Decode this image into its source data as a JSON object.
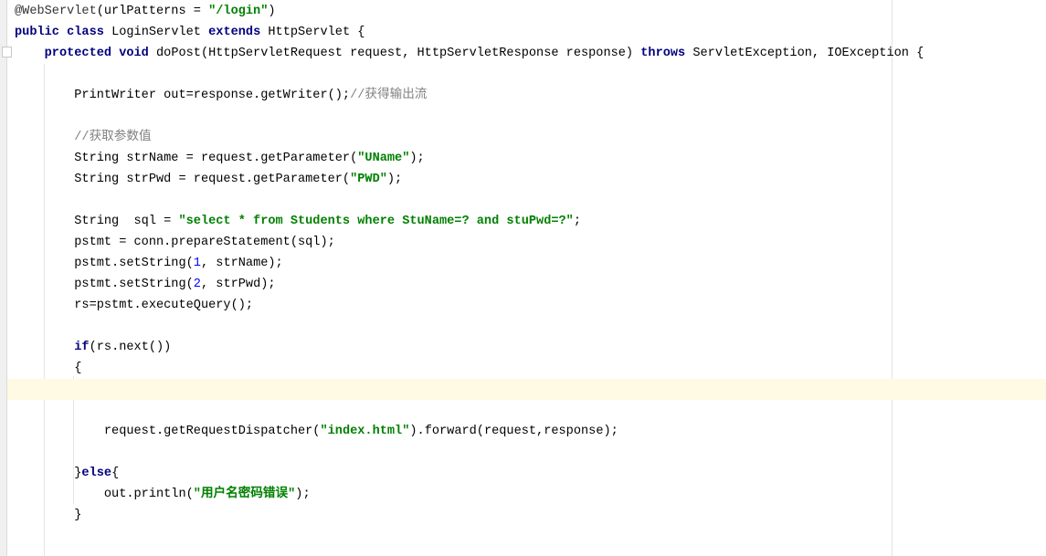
{
  "editor": {
    "current_line": 18,
    "lines": [
      [
        {
          "t": "@WebServlet",
          "c": "ann"
        },
        {
          "t": "(urlPatterns = ",
          "c": "plain"
        },
        {
          "t": "\"/login\"",
          "c": "str"
        },
        {
          "t": ")",
          "c": "plain"
        }
      ],
      [
        {
          "t": "public class ",
          "c": "kw"
        },
        {
          "t": "LoginServlet ",
          "c": "plain"
        },
        {
          "t": "extends ",
          "c": "kw"
        },
        {
          "t": "HttpServlet {",
          "c": "plain"
        }
      ],
      [
        {
          "t": "    protected void ",
          "c": "kw"
        },
        {
          "t": "doPost(HttpServletRequest request, HttpServletResponse response) ",
          "c": "plain"
        },
        {
          "t": "throws ",
          "c": "kw"
        },
        {
          "t": "ServletException, IOException {",
          "c": "plain"
        }
      ],
      [],
      [
        {
          "t": "        PrintWriter out=response.getWriter();",
          "c": "plain"
        },
        {
          "t": "//获得输出流",
          "c": "cmt"
        }
      ],
      [],
      [
        {
          "t": "        //获取参数值",
          "c": "cmt"
        }
      ],
      [
        {
          "t": "        String strName = request.getParameter(",
          "c": "plain"
        },
        {
          "t": "\"UName\"",
          "c": "str"
        },
        {
          "t": ");",
          "c": "plain"
        }
      ],
      [
        {
          "t": "        String strPwd = request.getParameter(",
          "c": "plain"
        },
        {
          "t": "\"PWD\"",
          "c": "str"
        },
        {
          "t": ");",
          "c": "plain"
        }
      ],
      [],
      [
        {
          "t": "        String  sql = ",
          "c": "plain"
        },
        {
          "t": "\"select * from Students where StuName=? and stuPwd=?\"",
          "c": "str"
        },
        {
          "t": ";",
          "c": "plain"
        }
      ],
      [
        {
          "t": "        pstmt = conn.prepareStatement(sql);",
          "c": "plain"
        }
      ],
      [
        {
          "t": "        pstmt.setString(",
          "c": "plain"
        },
        {
          "t": "1",
          "c": "num"
        },
        {
          "t": ", strName);",
          "c": "plain"
        }
      ],
      [
        {
          "t": "        pstmt.setString(",
          "c": "plain"
        },
        {
          "t": "2",
          "c": "num"
        },
        {
          "t": ", strPwd);",
          "c": "plain"
        }
      ],
      [
        {
          "t": "        rs=pstmt.executeQuery();",
          "c": "plain"
        }
      ],
      [],
      [
        {
          "t": "        ",
          "c": "plain"
        },
        {
          "t": "if",
          "c": "kw"
        },
        {
          "t": "(rs.next())",
          "c": "plain"
        }
      ],
      [
        {
          "t": "        {",
          "c": "plain"
        }
      ],
      [],
      [],
      [
        {
          "t": "            request.getRequestDispatcher(",
          "c": "plain"
        },
        {
          "t": "\"index.html\"",
          "c": "str"
        },
        {
          "t": ").forward(request,response);",
          "c": "plain"
        }
      ],
      [],
      [
        {
          "t": "        }",
          "c": "plain"
        },
        {
          "t": "else",
          "c": "kw"
        },
        {
          "t": "{",
          "c": "plain"
        }
      ],
      [
        {
          "t": "            out.println(",
          "c": "plain"
        },
        {
          "t": "\"用户名密码错误\"",
          "c": "str"
        },
        {
          "t": ");",
          "c": "plain"
        }
      ],
      [
        {
          "t": "        }",
          "c": "plain"
        }
      ],
      []
    ]
  }
}
